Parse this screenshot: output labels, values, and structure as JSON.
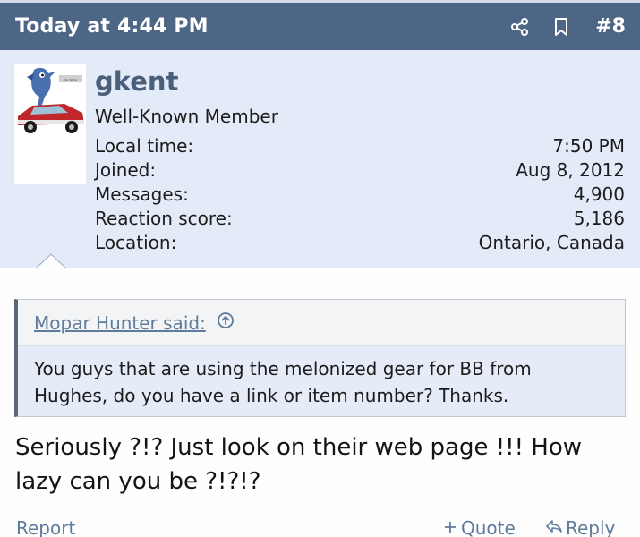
{
  "post": {
    "date": "Today at 4:44 PM",
    "number": "#8",
    "icons": {
      "share": "share-icon",
      "bookmark": "bookmark-icon"
    }
  },
  "user": {
    "name": "gkent",
    "title": "Well-Known Member",
    "stats": [
      {
        "label": "Local time:",
        "value": "7:50 PM"
      },
      {
        "label": "Joined:",
        "value": "Aug 8, 2012"
      },
      {
        "label": "Messages:",
        "value": "4,900"
      },
      {
        "label": "Reaction score:",
        "value": "5,186"
      },
      {
        "label": "Location:",
        "value": "Ontario, Canada"
      }
    ]
  },
  "quote": {
    "author_link": "Mopar Hunter said:",
    "text": "You guys that are using the melonized gear for BB from Hughes, do you have a link or item number? Thanks."
  },
  "message": {
    "text": "Seriously ?!? Just look on their web page !!! How lazy can you be ?!?!?"
  },
  "footer": {
    "report": "Report",
    "quote": "Quote",
    "reply": "Reply"
  },
  "colors": {
    "header_bg": "#4d6686",
    "user_block_bg": "#e4ebf8",
    "link": "#5e7b9c"
  }
}
